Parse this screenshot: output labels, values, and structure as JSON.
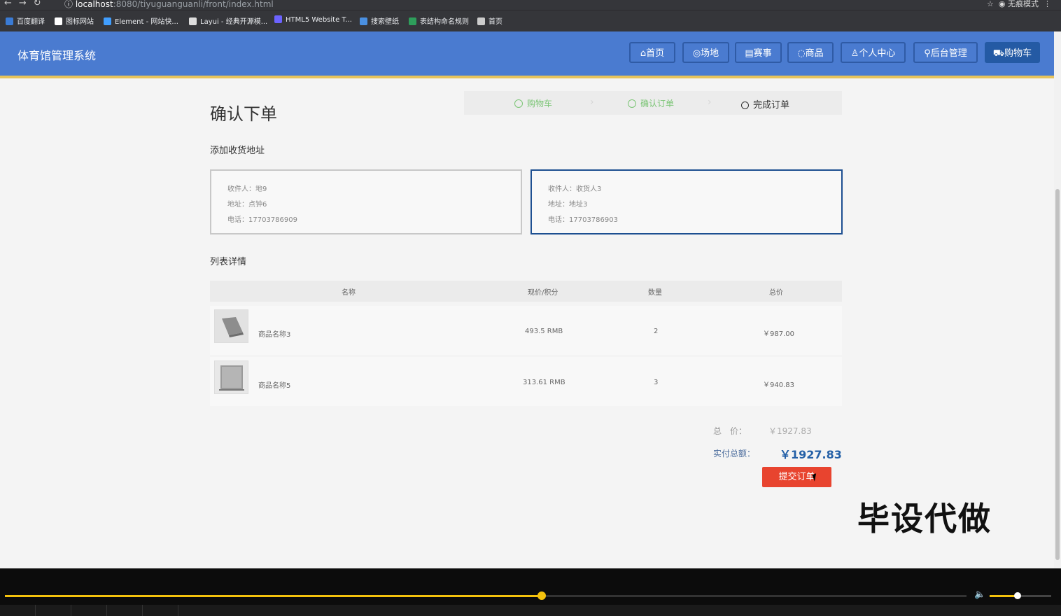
{
  "browser": {
    "url_host": "localhost",
    "url_path": ":8080/tiyuguanguanli/front/index.html",
    "incognito_label": "无痕模式",
    "bookmarks": [
      {
        "label": "百度翻译",
        "color": "#3a7bd5"
      },
      {
        "label": "图标网站",
        "color": "#ffffff"
      },
      {
        "label": "Element - 网站快...",
        "color": "#409eff"
      },
      {
        "label": "Layui - 经典开源模...",
        "color": "#dddddd"
      },
      {
        "label": "HTML5 Website T...",
        "color": "#6c63ff"
      },
      {
        "label": "搜索壁纸",
        "color": "#4a90e2"
      },
      {
        "label": "表结构命名规则",
        "color": "#2e9e5b"
      },
      {
        "label": "首页",
        "color": "#cccccc"
      }
    ]
  },
  "header": {
    "logo": "体育馆管理系统",
    "nav": [
      {
        "label": "首页",
        "icon": "home-icon",
        "glyph": "⌂"
      },
      {
        "label": "场地",
        "icon": "field-icon",
        "glyph": "◎"
      },
      {
        "label": "赛事",
        "icon": "event-icon",
        "glyph": "▤"
      },
      {
        "label": "商品",
        "icon": "goods-icon",
        "glyph": "◌"
      },
      {
        "label": "个人中心",
        "icon": "user-icon",
        "glyph": "♙"
      },
      {
        "label": "后台管理",
        "icon": "link-icon",
        "glyph": "⚲"
      },
      {
        "label": "购物车",
        "icon": "cart-icon",
        "glyph": "⛟"
      }
    ]
  },
  "page": {
    "title": "确认下单",
    "steps": [
      {
        "label": "购物车",
        "state": "done"
      },
      {
        "label": "确认订单",
        "state": "done"
      },
      {
        "label": "完成订单",
        "state": "current"
      }
    ],
    "address_section_title": "添加收货地址",
    "addresses": [
      {
        "recipient": "收件人：地9",
        "address": "地址：点钟6",
        "phone": "电话：17703786909",
        "selected": false
      },
      {
        "recipient": "收件人：收货人3",
        "address": "地址：地址3",
        "phone": "电话：17703786903",
        "selected": true
      }
    ],
    "list_section_title": "列表详情",
    "table": {
      "headers": [
        "名称",
        "现价/积分",
        "数量",
        "总价"
      ],
      "rows": [
        {
          "name": "商品名称3",
          "price": "493.5 RMB",
          "qty": "2",
          "total": "￥987.00"
        },
        {
          "name": "商品名称5",
          "price": "313.61 RMB",
          "qty": "3",
          "total": "￥940.83"
        }
      ]
    },
    "summary": {
      "total_label": "总　价：",
      "total_value": "￥1927.83",
      "paid_label": "实付总额：",
      "paid_value": "￥1927.83"
    },
    "submit_label": "提交订单",
    "watermark": "毕设代做"
  },
  "player": {
    "progress": 0.558,
    "volume": 0.45
  }
}
